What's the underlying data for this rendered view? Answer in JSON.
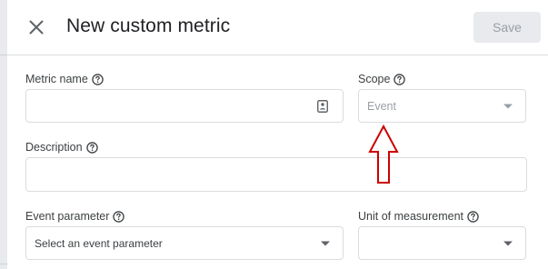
{
  "dialog": {
    "title": "New custom metric",
    "save_label": "Save"
  },
  "fields": {
    "metric_name": {
      "label": "Metric name",
      "value": ""
    },
    "scope": {
      "label": "Scope",
      "value": "Event"
    },
    "description": {
      "label": "Description",
      "value": ""
    },
    "event_parameter": {
      "label": "Event parameter",
      "placeholder": "Select an event parameter"
    },
    "unit_of_measurement": {
      "label": "Unit of measurement",
      "value": ""
    }
  },
  "icons": {
    "close": "close-icon",
    "help": "help-circle-icon",
    "contact_card": "contact-card-icon",
    "dropdown": "chevron-down-icon",
    "annotation_arrow": "red-up-arrow"
  },
  "colors": {
    "annotation": "#cc0000",
    "save_disabled_bg": "#e8eaed",
    "save_disabled_text": "#9aa0a6",
    "border": "#dadce0"
  }
}
